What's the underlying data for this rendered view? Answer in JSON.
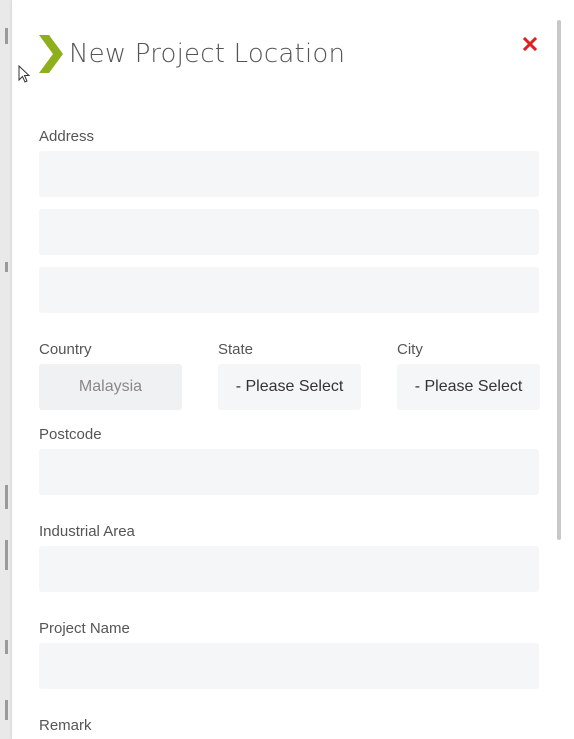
{
  "dialog": {
    "title": "New Project Location",
    "accent_color": "#8fae1b",
    "close_color": "#e02020"
  },
  "form": {
    "address_label": "Address",
    "address_line1": "",
    "address_line2": "",
    "address_line3": "",
    "country_label": "Country",
    "country_value": "Malaysia",
    "state_label": "State",
    "state_value": "- Please Select",
    "city_label": "City",
    "city_value": "- Please Select",
    "postcode_label": "Postcode",
    "postcode_value": "",
    "industrial_area_label": "Industrial Area",
    "industrial_area_value": "",
    "project_name_label": "Project Name",
    "project_name_value": "",
    "remark_label": "Remark"
  },
  "icons": {
    "chevron": "chevron-right-icon",
    "close": "close-icon",
    "cursor": "mouse-pointer-icon"
  }
}
